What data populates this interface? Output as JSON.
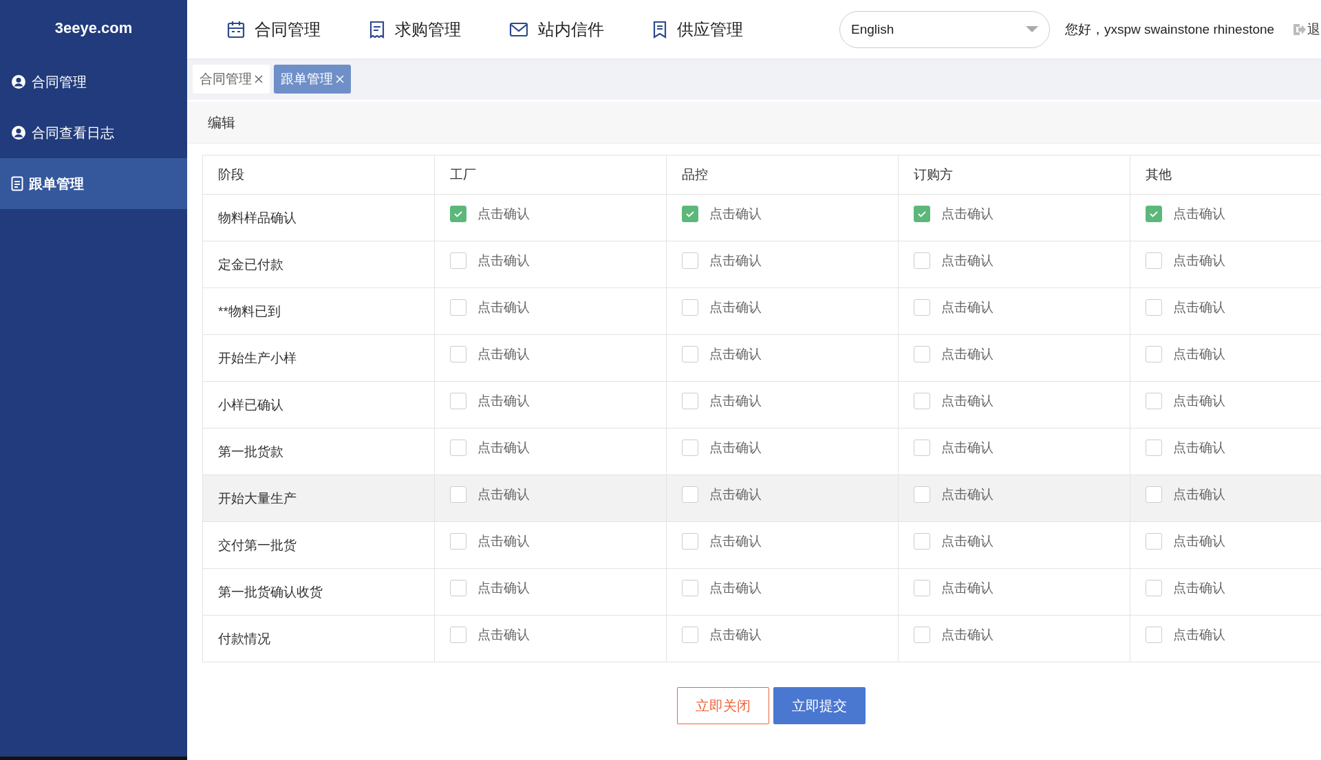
{
  "sidebar": {
    "logo": "3eeye.com",
    "items": [
      {
        "label": "合同管理",
        "selected": false
      },
      {
        "label": "合同查看日志",
        "selected": false
      },
      {
        "label": "跟单管理",
        "selected": true
      }
    ]
  },
  "topbar": {
    "nav": [
      "合同管理",
      "求购管理",
      "站内信件",
      "供应管理"
    ],
    "language": "English",
    "greeting": "您好，yxspw swainstone rhinestone",
    "logout": "退"
  },
  "tabs": [
    {
      "label": "合同管理",
      "selected": false
    },
    {
      "label": "跟单管理",
      "selected": true
    }
  ],
  "panel": {
    "title": "编辑"
  },
  "table": {
    "columns": [
      "阶段",
      "工厂",
      "品控",
      "订购方",
      "其他"
    ],
    "rows": [
      {
        "highlighted": false,
        "cells": [
          {
            "kind": "stage",
            "text": "物料样品确认"
          },
          {
            "kind": "check",
            "checked": true,
            "label": "点击确认"
          },
          {
            "kind": "check",
            "checked": true,
            "label": "点击确认"
          },
          {
            "kind": "check",
            "checked": true,
            "label": "点击确认"
          },
          {
            "kind": "check",
            "checked": true,
            "label": "点击确认"
          }
        ]
      },
      {
        "highlighted": false,
        "cells": [
          {
            "kind": "stage",
            "text": "定金已付款"
          },
          {
            "kind": "check",
            "checked": false,
            "label": "点击确认"
          },
          {
            "kind": "check",
            "checked": false,
            "label": "点击确认"
          },
          {
            "kind": "check",
            "checked": false,
            "label": "点击确认"
          },
          {
            "kind": "check",
            "checked": false,
            "label": "点击确认"
          }
        ]
      },
      {
        "highlighted": false,
        "cells": [
          {
            "kind": "stage",
            "text": "**物料已到"
          },
          {
            "kind": "check",
            "checked": false,
            "label": "点击确认"
          },
          {
            "kind": "check",
            "checked": false,
            "label": "点击确认"
          },
          {
            "kind": "check",
            "checked": false,
            "label": "点击确认"
          },
          {
            "kind": "check",
            "checked": false,
            "label": "点击确认"
          }
        ]
      },
      {
        "highlighted": false,
        "cells": [
          {
            "kind": "stage",
            "text": "开始生产小样"
          },
          {
            "kind": "check",
            "checked": false,
            "label": "点击确认"
          },
          {
            "kind": "check",
            "checked": false,
            "label": "点击确认"
          },
          {
            "kind": "check",
            "checked": false,
            "label": "点击确认"
          },
          {
            "kind": "check",
            "checked": false,
            "label": "点击确认"
          }
        ]
      },
      {
        "highlighted": false,
        "cells": [
          {
            "kind": "stage",
            "text": "小样已确认"
          },
          {
            "kind": "check",
            "checked": false,
            "label": "点击确认"
          },
          {
            "kind": "check",
            "checked": false,
            "label": "点击确认"
          },
          {
            "kind": "check",
            "checked": false,
            "label": "点击确认"
          },
          {
            "kind": "check",
            "checked": false,
            "label": "点击确认"
          }
        ]
      },
      {
        "highlighted": false,
        "cells": [
          {
            "kind": "stage",
            "text": "第一批货款"
          },
          {
            "kind": "check",
            "checked": false,
            "label": "点击确认"
          },
          {
            "kind": "check",
            "checked": false,
            "label": "点击确认"
          },
          {
            "kind": "check",
            "checked": false,
            "label": "点击确认"
          },
          {
            "kind": "check",
            "checked": false,
            "label": "点击确认"
          }
        ]
      },
      {
        "highlighted": true,
        "cells": [
          {
            "kind": "stage",
            "text": "开始大量生产"
          },
          {
            "kind": "check",
            "checked": false,
            "label": "点击确认"
          },
          {
            "kind": "check",
            "checked": false,
            "label": "点击确认"
          },
          {
            "kind": "check",
            "checked": false,
            "label": "点击确认"
          },
          {
            "kind": "check",
            "checked": false,
            "label": "点击确认"
          }
        ]
      },
      {
        "highlighted": false,
        "cells": [
          {
            "kind": "stage",
            "text": "交付第一批货"
          },
          {
            "kind": "check",
            "checked": false,
            "label": "点击确认"
          },
          {
            "kind": "check",
            "checked": false,
            "label": "点击确认"
          },
          {
            "kind": "check",
            "checked": false,
            "label": "点击确认"
          },
          {
            "kind": "check",
            "checked": false,
            "label": "点击确认"
          }
        ]
      },
      {
        "highlighted": false,
        "cells": [
          {
            "kind": "stage",
            "text": "第一批货确认收货"
          },
          {
            "kind": "check",
            "checked": false,
            "label": "点击确认"
          },
          {
            "kind": "check",
            "checked": false,
            "label": "点击确认"
          },
          {
            "kind": "check",
            "checked": false,
            "label": "点击确认"
          },
          {
            "kind": "check",
            "checked": false,
            "label": "点击确认"
          }
        ]
      },
      {
        "highlighted": false,
        "cells": [
          {
            "kind": "stage",
            "text": "付款情况"
          },
          {
            "kind": "check",
            "checked": false,
            "label": "点击确认"
          },
          {
            "kind": "check",
            "checked": false,
            "label": "点击确认"
          },
          {
            "kind": "check",
            "checked": false,
            "label": "点击确认"
          },
          {
            "kind": "check",
            "checked": false,
            "label": "点击确认"
          }
        ]
      }
    ]
  },
  "buttons": [
    {
      "label": "立即关闭",
      "kind": "secondary"
    },
    {
      "label": "立即提交",
      "kind": "primary"
    }
  ]
}
